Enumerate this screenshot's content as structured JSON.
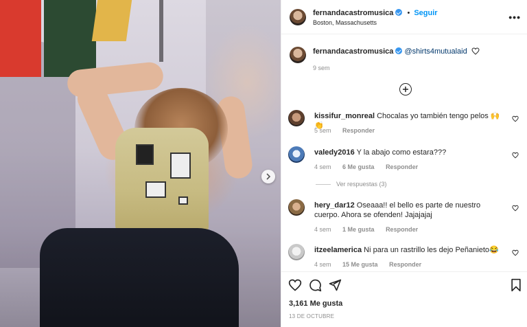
{
  "post": {
    "author": "fernandacastromusica",
    "follow_label": "Seguir",
    "separator": "•",
    "location": "Boston, Massachusetts",
    "more_label": "•••",
    "caption_mention": "@shirts4mutualaid",
    "caption_time": "9 sem",
    "likes_text": "3,161 Me gusta",
    "date_text": "13 DE OCTUBRE"
  },
  "comments": [
    {
      "user": "kissifur_monreal",
      "text": "Chocalas yo también tengo pelos 🙌👏",
      "time": "5 sem",
      "likes": "",
      "reply": "Responder"
    },
    {
      "user": "valedy2016",
      "text": "Y la abajo como estara???",
      "time": "4 sem",
      "likes": "6 Me gusta",
      "reply": "Responder"
    },
    {
      "user": "hery_dar12",
      "text": "Oseaaa!! el bello es parte de nuestro cuerpo. Ahora se ofenden! Jajajajaj",
      "time": "4 sem",
      "likes": "1 Me gusta",
      "reply": "Responder"
    },
    {
      "user": "itzeelamerica",
      "text": "Ni para un rastrillo les dejo Peñanieto😂",
      "time": "4 sem",
      "likes": "15 Me gusta",
      "reply": "Responder"
    }
  ],
  "view_replies": "Ver respuestas (3)",
  "icons": {
    "heart": "heart-icon",
    "comment": "comment-icon",
    "share": "share-icon",
    "save": "bookmark-icon",
    "load_more": "plus-circle-icon",
    "next": "chevron-right-icon",
    "verified": "verified-badge-icon"
  },
  "colors": {
    "link_blue": "#0095f6",
    "verified": "#3897f0",
    "muted": "#8e8e8e"
  }
}
